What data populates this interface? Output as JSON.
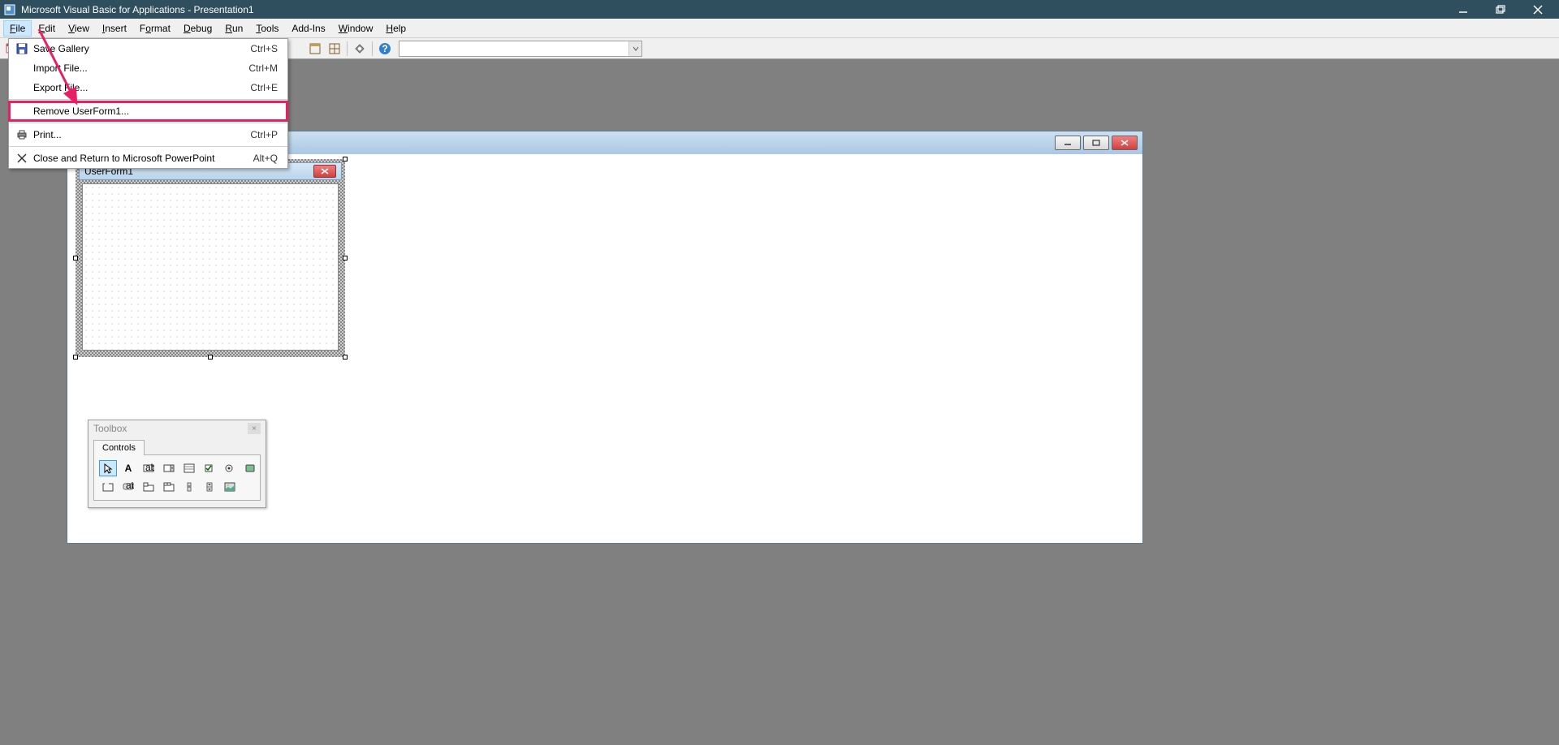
{
  "titlebar": {
    "text": "Microsoft Visual Basic for Applications - Presentation1"
  },
  "menubar": {
    "items": [
      {
        "label": "File",
        "u": "F",
        "rest": "ile"
      },
      {
        "label": "Edit",
        "u": "E",
        "rest": "dit"
      },
      {
        "label": "View",
        "u": "V",
        "rest": "iew"
      },
      {
        "label": "Insert",
        "u": "I",
        "rest": "nsert"
      },
      {
        "label": "Format",
        "u": "",
        "rest": "Format",
        "uIndex": 1
      },
      {
        "label": "Debug",
        "u": "D",
        "rest": "ebug"
      },
      {
        "label": "Run",
        "u": "R",
        "rest": "un"
      },
      {
        "label": "Tools",
        "u": "T",
        "rest": "ools"
      },
      {
        "label": "Add-Ins",
        "u": "",
        "rest": "Add-Ins"
      },
      {
        "label": "Window",
        "u": "W",
        "rest": "indow"
      },
      {
        "label": "Help",
        "u": "H",
        "rest": "elp"
      }
    ]
  },
  "file_menu": {
    "items": [
      {
        "icon": "save-icon",
        "label": "Save Gallery",
        "shortcut": "Ctrl+S"
      },
      {
        "icon": "",
        "label": "Import File...",
        "shortcut": "Ctrl+M"
      },
      {
        "icon": "",
        "label": "Export File...",
        "shortcut": "Ctrl+E"
      },
      {
        "separator": true
      },
      {
        "icon": "",
        "label": "Remove UserForm1...",
        "shortcut": "",
        "highlighted": true
      },
      {
        "separator": true
      },
      {
        "icon": "print-icon",
        "label": "Print...",
        "shortcut": "Ctrl+P"
      },
      {
        "separator": true
      },
      {
        "icon": "close-icon",
        "label": "Close and Return to Microsoft PowerPoint",
        "shortcut": "Alt+Q"
      }
    ]
  },
  "userform": {
    "caption": "UserForm1"
  },
  "toolbox": {
    "title": "Toolbox",
    "tab": "Controls",
    "tools": [
      "pointer",
      "label",
      "textbox",
      "combobox",
      "listbox",
      "checkbox",
      "optionbutton",
      "togglebutton",
      "frame",
      "commandbutton",
      "tabstrip",
      "multipage",
      "scrollbar",
      "spinbutton",
      "image",
      ""
    ]
  }
}
